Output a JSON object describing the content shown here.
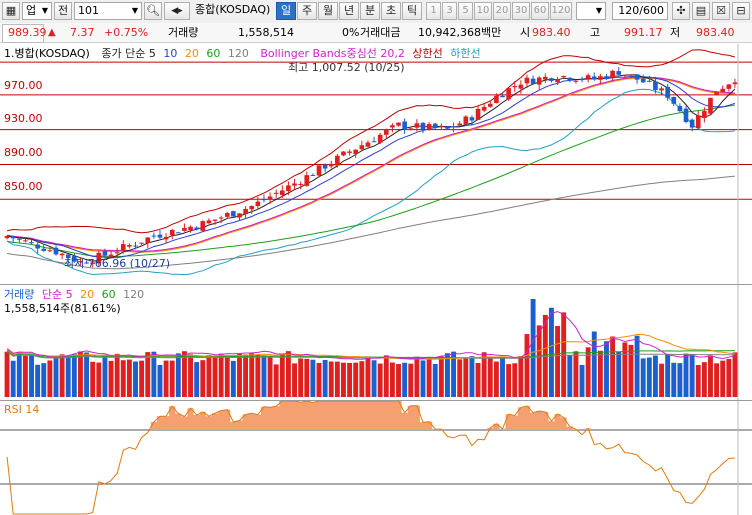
{
  "toolbar": {
    "market_select": "업",
    "market_toggle": "전",
    "code": "101",
    "index_name": "종합(KOSDAQ)",
    "periods": [
      "일",
      "주",
      "월",
      "년",
      "분",
      "초",
      "틱"
    ],
    "active_period": "일",
    "intervals": [
      "1",
      "3",
      "5",
      "10",
      "20",
      "30",
      "60",
      "120"
    ],
    "count_display": "120/600"
  },
  "quote": {
    "price": "989.39",
    "direction": "▲",
    "change": "7.37",
    "change_pct": "+0.75%",
    "volume_label": "거래량",
    "volume": "1,558,514",
    "volume_pct": "0%",
    "amount_label": "거래대금",
    "amount": "10,942,368백만",
    "open_label": "시",
    "open": "983.40",
    "high_label": "고",
    "high": "991.17",
    "low_label": "저",
    "low": "983.40"
  },
  "price_panel": {
    "legend_title": "1.병합(KOSDAQ)",
    "legend_ma": "종가 단순 5",
    "ma_periods": [
      "10",
      "20",
      "60",
      "120"
    ],
    "legend_bb": "Bollinger Bands중심선 20,2",
    "legend_upper": "상한선",
    "legend_lower": "하한선",
    "y_ticks": [
      "970.00",
      "930.00",
      "890.00",
      "850.00"
    ],
    "max_label": "최고 1,007.52 (10/25)",
    "min_label": "최저 766.96 (10/27)"
  },
  "volume_panel": {
    "legend_title": "거래량",
    "legend_ma": "단순 5",
    "ma_periods": [
      "20",
      "60",
      "120"
    ],
    "value_label": "1,558,514주(81.61%)"
  },
  "rsi_panel": {
    "legend_title": "RSI 14"
  },
  "colors": {
    "up": "#e02020",
    "down": "#1c5fcf",
    "ma5": "#222222",
    "ma10": "#2a3fd0",
    "ma20": "#ff8c00",
    "ma60": "#1aa01a",
    "ma120": "#808080",
    "bb_mid": "#d020d0",
    "bb_upper": "#c00000",
    "bb_lower": "#20a0c0",
    "rsi": "#e07a10"
  },
  "chart_data": {
    "type": "candlestick",
    "bars": 120,
    "price_ylim": [
      755,
      1010
    ],
    "price_ticks": [
      970,
      930,
      890,
      850
    ],
    "max": {
      "value": 1007.52,
      "date": "10/25"
    },
    "min": {
      "value": 766.96,
      "date": "10/27"
    },
    "last_close": 989.39,
    "volume_last": 1558514,
    "rsi_period": 14
  }
}
